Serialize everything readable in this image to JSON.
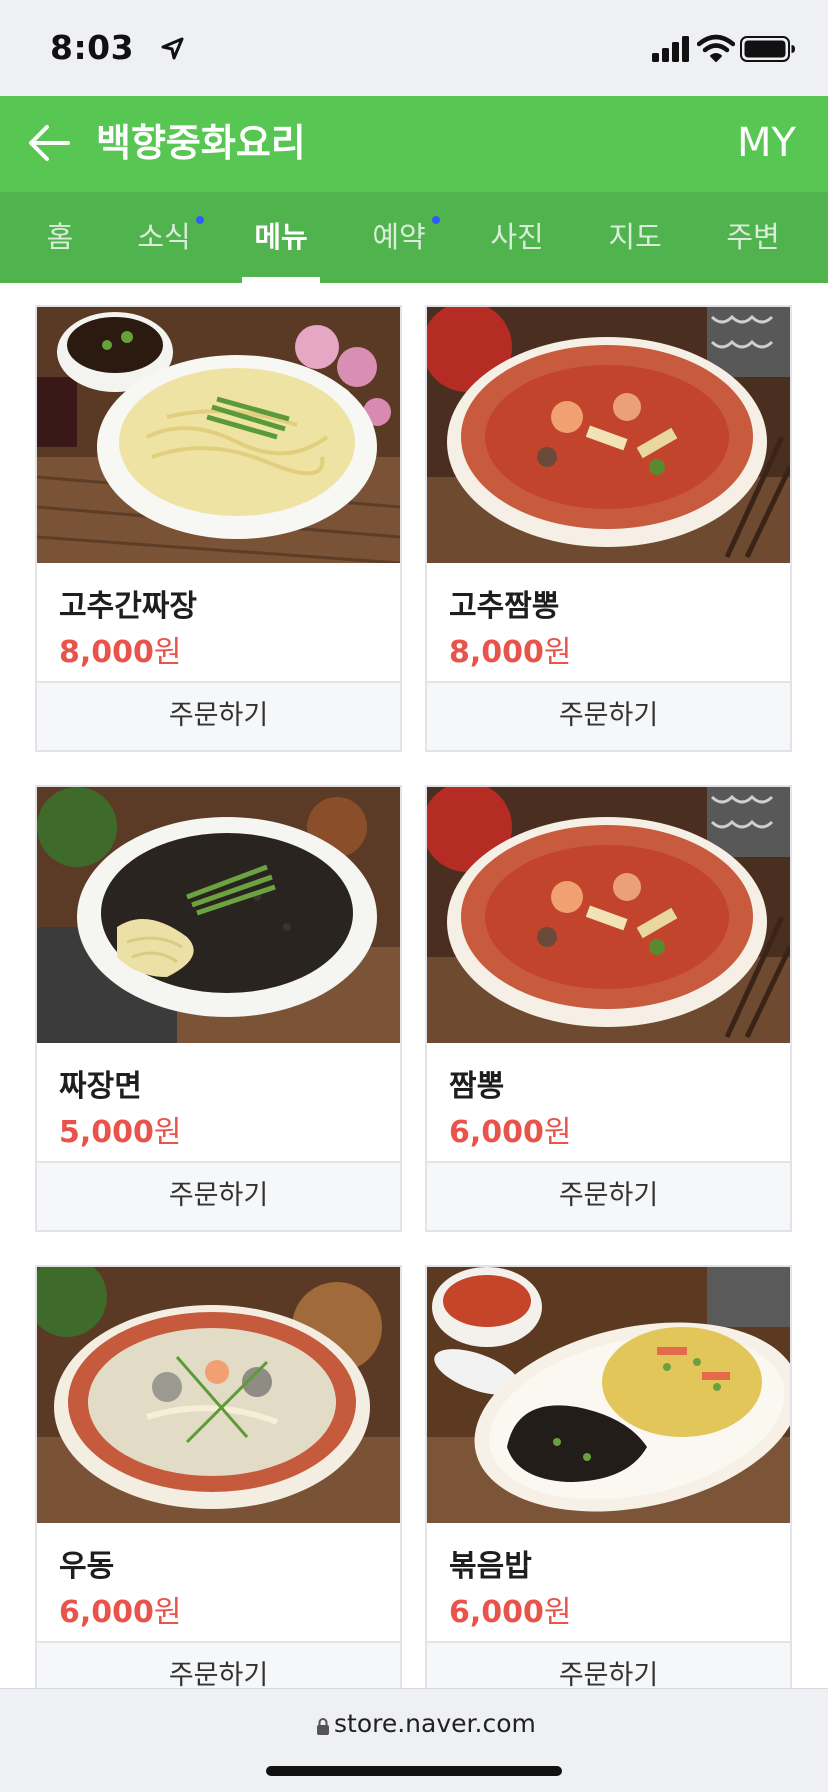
{
  "status_bar": {
    "time": "8:03",
    "icons": [
      "location-arrow-icon",
      "cellular-signal-icon",
      "wifi-icon",
      "battery-icon"
    ]
  },
  "header": {
    "back_icon": "back-arrow-icon",
    "title": "백향중화요리",
    "my_label": "MY",
    "background_color": "#58c653"
  },
  "tabs": [
    {
      "label": "홈",
      "active": false,
      "dot": false
    },
    {
      "label": "소식",
      "active": false,
      "dot": true
    },
    {
      "label": "메뉴",
      "active": true,
      "dot": false
    },
    {
      "label": "예약",
      "active": false,
      "dot": true
    },
    {
      "label": "사진",
      "active": false,
      "dot": false
    },
    {
      "label": "지도",
      "active": false,
      "dot": false
    },
    {
      "label": "주변",
      "active": false,
      "dot": false
    }
  ],
  "menu_items": [
    {
      "name": "고추간짜장",
      "price_number": "8,000",
      "price_unit": "원",
      "order_label": "주문하기",
      "photo": "jjajang-noodles-separate-sauce"
    },
    {
      "name": "고추짬뽕",
      "price_number": "8,000",
      "price_unit": "원",
      "order_label": "주문하기",
      "photo": "spicy-seafood-noodle-soup"
    },
    {
      "name": "짜장면",
      "price_number": "5,000",
      "price_unit": "원",
      "order_label": "주문하기",
      "photo": "black-bean-noodles"
    },
    {
      "name": "짬뽕",
      "price_number": "6,000",
      "price_unit": "원",
      "order_label": "주문하기",
      "photo": "spicy-seafood-noodle-soup"
    },
    {
      "name": "우동",
      "price_number": "6,000",
      "price_unit": "원",
      "order_label": "주문하기",
      "photo": "white-seafood-udon"
    },
    {
      "name": "볶음밥",
      "price_number": "6,000",
      "price_unit": "원",
      "order_label": "주문하기",
      "photo": "fried-rice-with-black-bean-sauce"
    }
  ],
  "price_color": "#e8534b",
  "url_bar": {
    "lock_icon": "lock-icon",
    "url": "store.naver.com"
  }
}
